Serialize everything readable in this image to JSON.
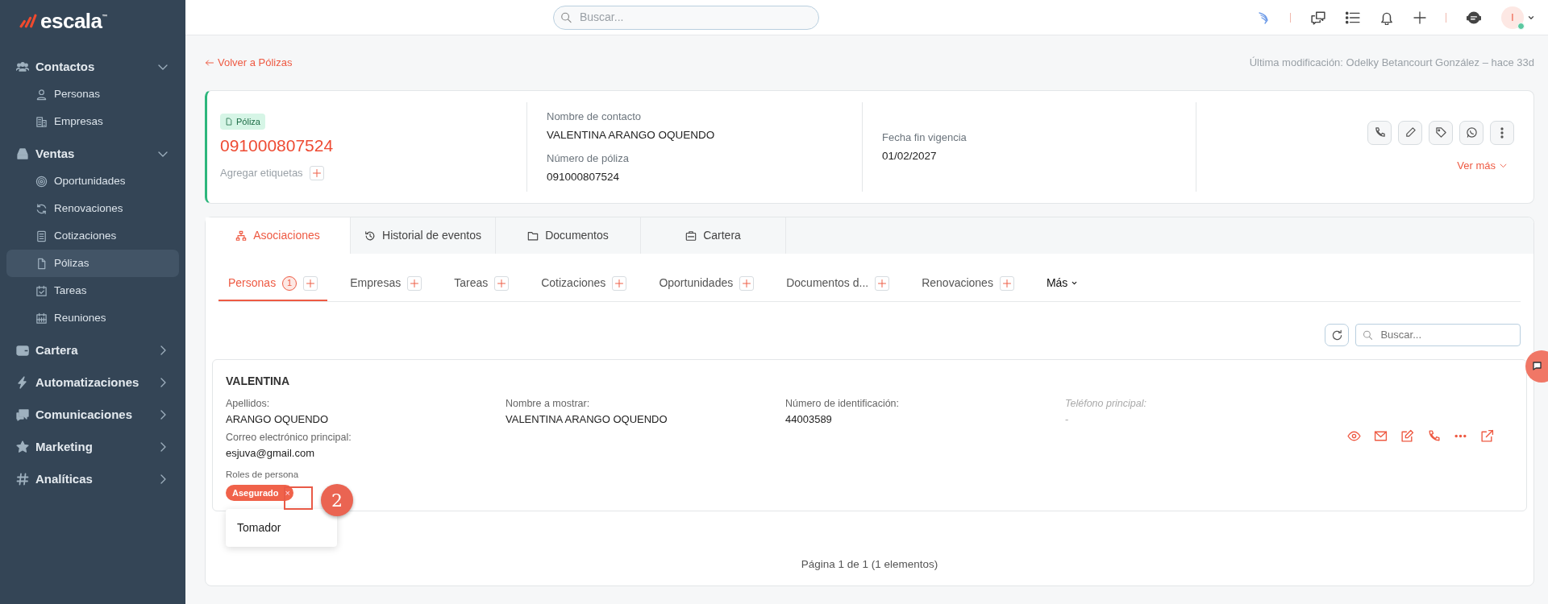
{
  "logo": {
    "text": "escala",
    "mark": "™"
  },
  "sidebar": {
    "sections": [
      {
        "label": "Contactos",
        "expanded": true,
        "children": [
          {
            "label": "Personas",
            "selected": false
          },
          {
            "label": "Empresas",
            "selected": false
          }
        ]
      },
      {
        "label": "Ventas",
        "expanded": true,
        "children": [
          {
            "label": "Oportunidades",
            "selected": false
          },
          {
            "label": "Renovaciones",
            "selected": false
          },
          {
            "label": "Cotizaciones",
            "selected": false
          },
          {
            "label": "Pólizas",
            "selected": true
          },
          {
            "label": "Tareas",
            "selected": false
          },
          {
            "label": "Reuniones",
            "selected": false
          }
        ]
      },
      {
        "label": "Cartera",
        "expanded": false
      },
      {
        "label": "Automatizaciones",
        "expanded": false
      },
      {
        "label": "Comunicaciones",
        "expanded": false
      },
      {
        "label": "Marketing",
        "expanded": false
      },
      {
        "label": "Analíticas",
        "expanded": false
      }
    ]
  },
  "topbar": {
    "search": {
      "placeholder": "Buscar..."
    },
    "user": {
      "initial": "I",
      "online": true
    }
  },
  "back_link": "Volver a Pólizas",
  "last_modified": "Última modificación: Odelky Betancourt González – hace 33d",
  "header": {
    "badge": "Póliza",
    "policy_number": "091000807524",
    "add_tags": "Agregar etiquetas",
    "fields": [
      {
        "label": "Nombre de contacto",
        "value": "VALENTINA ARANGO OQUENDO"
      },
      {
        "label": "Número de póliza",
        "value": "091000807524"
      }
    ],
    "date_field": {
      "label": "Fecha fin vigencia",
      "value": "01/02/2027"
    },
    "more": "Ver más"
  },
  "tabs": [
    {
      "label": "Asociaciones",
      "selected": true
    },
    {
      "label": "Historial de eventos",
      "selected": false
    },
    {
      "label": "Documentos",
      "selected": false
    },
    {
      "label": "Cartera",
      "selected": false
    }
  ],
  "subtabs": [
    {
      "label": "Personas",
      "count": "1",
      "selected": true
    },
    {
      "label": "Empresas",
      "selected": false
    },
    {
      "label": "Tareas",
      "selected": false
    },
    {
      "label": "Cotizaciones",
      "selected": false
    },
    {
      "label": "Oportunidades",
      "selected": false
    },
    {
      "label": "Documentos d...",
      "selected": false
    },
    {
      "label": "Renovaciones",
      "selected": false
    }
  ],
  "subtabs_more": "Más",
  "list_search": {
    "placeholder": "Buscar..."
  },
  "person": {
    "name": "VALENTINA",
    "fields": [
      {
        "label": "Apellidos:",
        "value": "ARANGO OQUENDO",
        "missing": false
      },
      {
        "label": "Nombre a mostrar:",
        "value": "VALENTINA ARANGO OQUENDO",
        "missing": false
      },
      {
        "label": "Número de identificación:",
        "value": "44003589",
        "missing": false
      },
      {
        "label": "Teléfono principal:",
        "value": "-",
        "missing": true
      }
    ],
    "email": {
      "label": "Correo electrónico principal:",
      "value": "esjuva@gmail.com"
    },
    "roles_label": "Roles de persona",
    "roles": [
      {
        "label": "Asegurado",
        "remove": "×"
      }
    ],
    "role_options": [
      "Tomador"
    ]
  },
  "callout": "2",
  "pagination": "Página 1 de 1 (1 elementos)"
}
